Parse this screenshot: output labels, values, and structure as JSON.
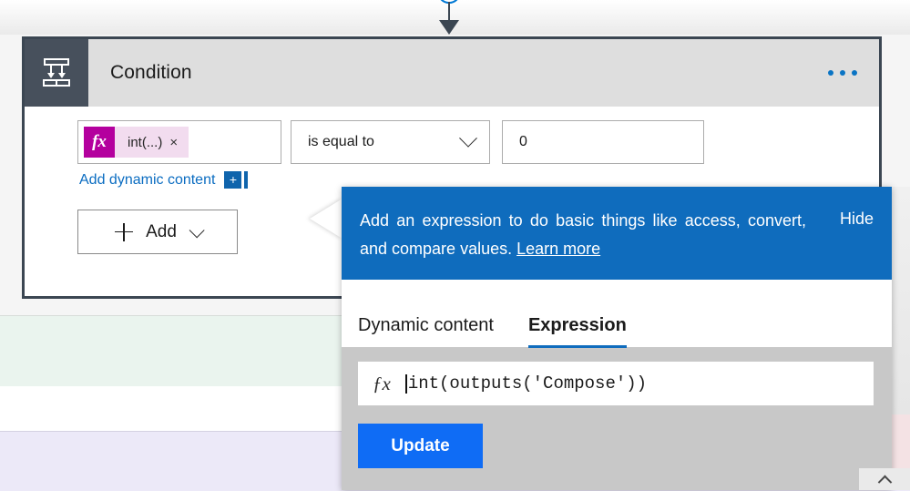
{
  "canvas": {
    "connector": {
      "icon": "plus-circle-icon",
      "arrow": "arrow-down-icon"
    }
  },
  "card": {
    "icon": "condition-branch-icon",
    "title": "Condition",
    "menu": "ellipsis-icon",
    "condition": {
      "token": {
        "fx_badge": "fx",
        "label": "int(...)",
        "remove": "×"
      },
      "operator": "is equal to",
      "operator_chevron": "chevron-down-icon",
      "value": "0"
    },
    "add_dynamic_content": {
      "label": "Add dynamic content",
      "badge": "+"
    },
    "add_button": {
      "plus": "plus-icon",
      "label": "Add",
      "chevron": "chevron-down-icon"
    }
  },
  "callout": {
    "banner": {
      "text_before_link": "Add an expression to do basic things like access, convert, and compare values. ",
      "link": "Learn more",
      "hide": "Hide"
    },
    "tabs": [
      {
        "label": "Dynamic content",
        "active": false
      },
      {
        "label": "Expression",
        "active": true
      }
    ],
    "expression_editor": {
      "fx_symbol": "ƒx",
      "value": "int(outputs('Compose'))"
    },
    "update_label": "Update"
  },
  "footer": {
    "collapse_caret": "chevron-up-icon"
  },
  "colors": {
    "accent_blue": "#0f6cbd",
    "button_blue": "#0f6cf5",
    "link_blue": "#0a6cc1",
    "card_border": "#3b4652",
    "icon_tile": "#47505c",
    "header_gray": "#dedede",
    "token_magenta": "#b4009e",
    "token_bg": "#f2dcef",
    "editor_gray": "#c8c8c8",
    "band_green": "#eaf4ee",
    "band_lavender": "#ece9f8"
  }
}
